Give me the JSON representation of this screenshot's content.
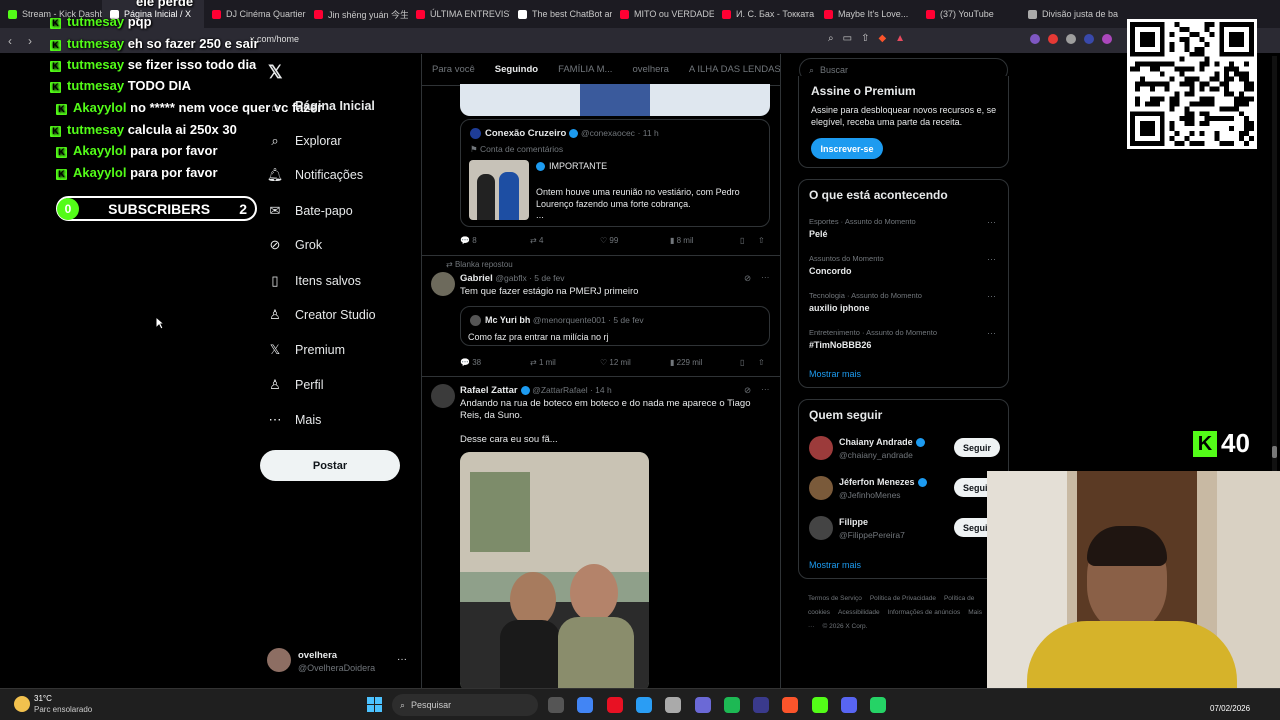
{
  "browser": {
    "tabs": [
      {
        "label": "Stream - Kick Dashb",
        "color": "#53fc18"
      },
      {
        "label": "Página Inicial / X",
        "color": "#ffffff",
        "active": true
      },
      {
        "label": "DJ Cinéma Quartier",
        "color": "#ff0033"
      },
      {
        "label": "Jin shēng yuán 今生",
        "color": "#ff0033"
      },
      {
        "label": "ÚLTIMA ENTREVISTA",
        "color": "#ff0033"
      },
      {
        "label": "The best ChatBot ar",
        "color": "#ffffff"
      },
      {
        "label": "MITO ou VERDADE",
        "color": "#ff0033"
      },
      {
        "label": "И. С. Бах - Токката",
        "color": "#ff0033"
      },
      {
        "label": "Maybe It's Love...",
        "color": "#ff0033"
      },
      {
        "label": "(37) YouTube",
        "color": "#ff0033"
      },
      {
        "label": "Divisão justa de ba",
        "color": "#aaaaaa"
      }
    ],
    "url": "x.com/home"
  },
  "chat": [
    {
      "user": "",
      "message": "ele perde"
    },
    {
      "user": "tutmesay",
      "message": "pqp"
    },
    {
      "user": "tutmesay",
      "message": "eh so fazer 250 e sair"
    },
    {
      "user": "tutmesay",
      "message": "se fizer isso todo dia"
    },
    {
      "user": "tutmesay",
      "message": "TODO DIA"
    },
    {
      "user": "Akayylol",
      "message": "no ***** nem voce quer vc fazer"
    },
    {
      "user": "tutmesay",
      "message": "calcula ai 250x 30"
    },
    {
      "user": "Akayylol",
      "message": "para por favor"
    },
    {
      "user": "Akayylol",
      "message": "para por favor"
    }
  ],
  "subscribers": {
    "left": "0",
    "label": "SUBSCRIBERS",
    "right": "2"
  },
  "nav": {
    "items": [
      {
        "label": "Página Inicial",
        "icon": "home-icon"
      },
      {
        "label": "Explorar",
        "icon": "search-icon"
      },
      {
        "label": "Notificações",
        "icon": "bell-icon"
      },
      {
        "label": "Bate-papo",
        "icon": "chat-icon"
      },
      {
        "label": "Grok",
        "icon": "grok-icon"
      },
      {
        "label": "Itens salvos",
        "icon": "bookmark-icon"
      },
      {
        "label": "Creator Studio",
        "icon": "creator-icon"
      },
      {
        "label": "Premium",
        "icon": "x-icon"
      },
      {
        "label": "Perfil",
        "icon": "profile-icon"
      },
      {
        "label": "Mais",
        "icon": "more-icon"
      }
    ],
    "post": "Postar",
    "account": {
      "name": "ovelhera",
      "handle": "@OvelheraDoidera"
    }
  },
  "feed": {
    "tabs": [
      "Para você",
      "Seguindo",
      "FAMÍLIA M...",
      "ovelhera",
      "A ILHA DAS LENDAS"
    ],
    "quote1": {
      "name": "Conexão Cruzeiro",
      "handle": "@conexaocec",
      "time": "11 h",
      "badge": "Conta de comentários",
      "tag": "IMPORTANTE",
      "text": "Ontem houve uma reunião no vestiário, com Pedro Lourenço fazendo uma forte cobrança.",
      "ellipsis": "..."
    },
    "actions1": {
      "replies": "8",
      "reposts": "4",
      "likes": "99",
      "views": "8 mil"
    },
    "tweet2": {
      "repost": "Blanka repostou",
      "name": "Gabriel",
      "handle": "@gabflx",
      "time": "5 de fev",
      "text": "Tem que fazer estágio na PMERJ primeiro",
      "quote_name": "Mc Yuri bh",
      "quote_handle": "@menorquente001",
      "quote_time": "5 de fev",
      "quote_text": "Como faz pra entrar na milícia no rj"
    },
    "actions2": {
      "replies": "38",
      "reposts": "1 mil",
      "likes": "12 mil",
      "views": "229 mil"
    },
    "tweet3": {
      "name": "Rafael Zattar",
      "handle": "@ZattarRafael",
      "time": "14 h",
      "text": "Andando na rua de boteco em boteco e do nada me aparece o Tiago Reis, da Suno.",
      "text2": "Desse cara eu sou fã..."
    }
  },
  "right": {
    "search_placeholder": "Buscar",
    "premium": {
      "title": "Assine o Premium",
      "text": "Assine para desbloquear novos recursos e, se elegível, receba uma parte da receita.",
      "button": "Inscrever-se"
    },
    "trends": {
      "title": "O que está acontecendo",
      "items": [
        {
          "cat": "Esportes · Assunto do Momento",
          "name": "Pelé"
        },
        {
          "cat": "Assuntos do Momento",
          "name": "Concordo"
        },
        {
          "cat": "Tecnologia · Assunto do Momento",
          "name": "auxilio iphone"
        },
        {
          "cat": "Entretenimento · Assunto do Momento",
          "name": "#TimNoBBB26"
        }
      ],
      "more": "Mostrar mais"
    },
    "who": {
      "title": "Quem seguir",
      "items": [
        {
          "name": "Chaiany Andrade",
          "handle": "@chaiany_andrade",
          "button": "Seguir"
        },
        {
          "name": "Jéferfon Menezes",
          "handle": "@JefinhoMenes",
          "button": "Seguir"
        },
        {
          "name": "Filippe",
          "handle": "@FilippePereira7",
          "button": "Seguir"
        }
      ],
      "more": "Mostrar mais"
    },
    "footer": [
      "Termos de Serviço",
      "Política de Privacidade",
      "Política de cookies",
      "Acessibilidade",
      "Informações de anúncios",
      "Mais ···",
      "© 2026 X Corp."
    ]
  },
  "kick_count": "40",
  "taskbar": {
    "weather_temp": "31°C",
    "weather_desc": "Parc ensolarado",
    "search": "Pesquisar",
    "date": "07/02/2026"
  }
}
